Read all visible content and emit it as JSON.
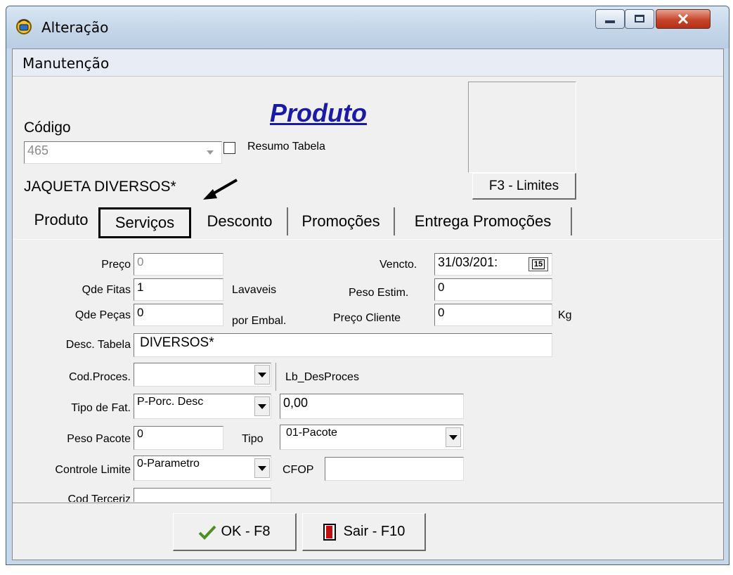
{
  "window": {
    "title": "Alteração"
  },
  "menu": {
    "items": [
      "Manutenção"
    ]
  },
  "header": {
    "heading": "Produto",
    "codigo_label": "Código",
    "codigo_value": "465",
    "resumo_label": "Resumo Tabela",
    "product_name": "JAQUETA DIVERSOS*",
    "limites_button": "F3 - Limites"
  },
  "tabs": [
    "Produto",
    "Serviços",
    "Desconto",
    "Promoções",
    "Entrega Promoções"
  ],
  "form": {
    "preco": {
      "label": "Preço",
      "value": "0"
    },
    "qde_fitas": {
      "label": "Qde Fitas",
      "value": "1",
      "suffix": "Lavaveis"
    },
    "qde_pecas": {
      "label": "Qde Peças",
      "value": "0",
      "suffix": "por Embal."
    },
    "desc_tabela": {
      "label": "Desc. Tabela",
      "value": "DIVERSOS*"
    },
    "cod_proces": {
      "label": "Cod.Proces.",
      "value": "",
      "desc": "Lb_DesProces"
    },
    "tipo_fat": {
      "label": "Tipo de Fat.",
      "value": "P-Porc. Desc",
      "amount": "0,00"
    },
    "peso_pacote": {
      "label": "Peso Pacote",
      "value": "0"
    },
    "tipo": {
      "label": "Tipo",
      "value": "01-Pacote"
    },
    "controle_limite": {
      "label": "Controle Limite",
      "value": "0-Parametro"
    },
    "cfop": {
      "label": "CFOP",
      "value": ""
    },
    "cod_terceiriz": {
      "label": "Cod Terceriz",
      "value": ""
    },
    "vencto": {
      "label": "Vencto.",
      "value": "31/03/201:",
      "cal_icon_text": "15"
    },
    "peso_estim": {
      "label": "Peso Estim.",
      "value": "0"
    },
    "preco_cliente": {
      "label": "Preço Cliente",
      "value": "0",
      "unit": "Kg"
    }
  },
  "footer": {
    "ok_label": "OK - F8",
    "exit_label": "Sair - F10"
  },
  "colors": {
    "title_blue": "#1a1aa6",
    "highlight_box": "#000000",
    "window_frame": "#c7d8ea"
  }
}
